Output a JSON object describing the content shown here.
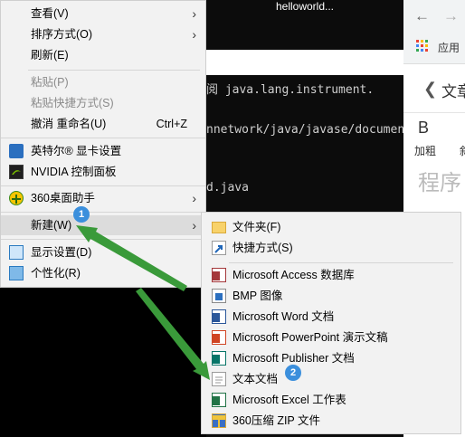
{
  "console": {
    "title": "helloworld...",
    "lines": [
      " 阅 java.lang.instrument.",
      "nnetwork/java/javase/documen",
      "d.java"
    ]
  },
  "browser": {
    "back_icon": "back-arrow-icon",
    "forward_icon": "forward-arrow-icon",
    "apps_label": "应用",
    "prev_label": "文章",
    "bold_letter": "B",
    "bold_label": "加粗",
    "truncated_char": "斜",
    "heading": "程序"
  },
  "context_menu": {
    "items": {
      "view": "查看(V)",
      "sort": "排序方式(O)",
      "refresh": "刷新(E)",
      "paste": "粘贴(P)",
      "paste_shortcut": "粘贴快捷方式(S)",
      "undo_rename": "撤消 重命名(U)",
      "undo_shortcut": "Ctrl+Z",
      "intel_graphics": "英特尔® 显卡设置",
      "nvidia_panel": "NVIDIA 控制面板",
      "desktop_helper": "360桌面助手",
      "new": "新建(W)",
      "display_settings": "显示设置(D)",
      "personalize": "个性化(R)"
    }
  },
  "new_submenu": {
    "items": {
      "folder": "文件夹(F)",
      "shortcut": "快捷方式(S)",
      "access": "Microsoft Access 数据库",
      "bmp": "BMP 图像",
      "word": "Microsoft Word 文档",
      "powerpoint": "Microsoft PowerPoint 演示文稿",
      "publisher": "Microsoft Publisher 文档",
      "text": "文本文档",
      "excel": "Microsoft Excel 工作表",
      "zip": "360压缩 ZIP 文件"
    }
  },
  "badges": {
    "step1": "1",
    "step2": "2"
  },
  "colors": {
    "arrow": "#3a9a3a",
    "badge": "#3b8fdc",
    "highlight": "#dcdcdc"
  }
}
